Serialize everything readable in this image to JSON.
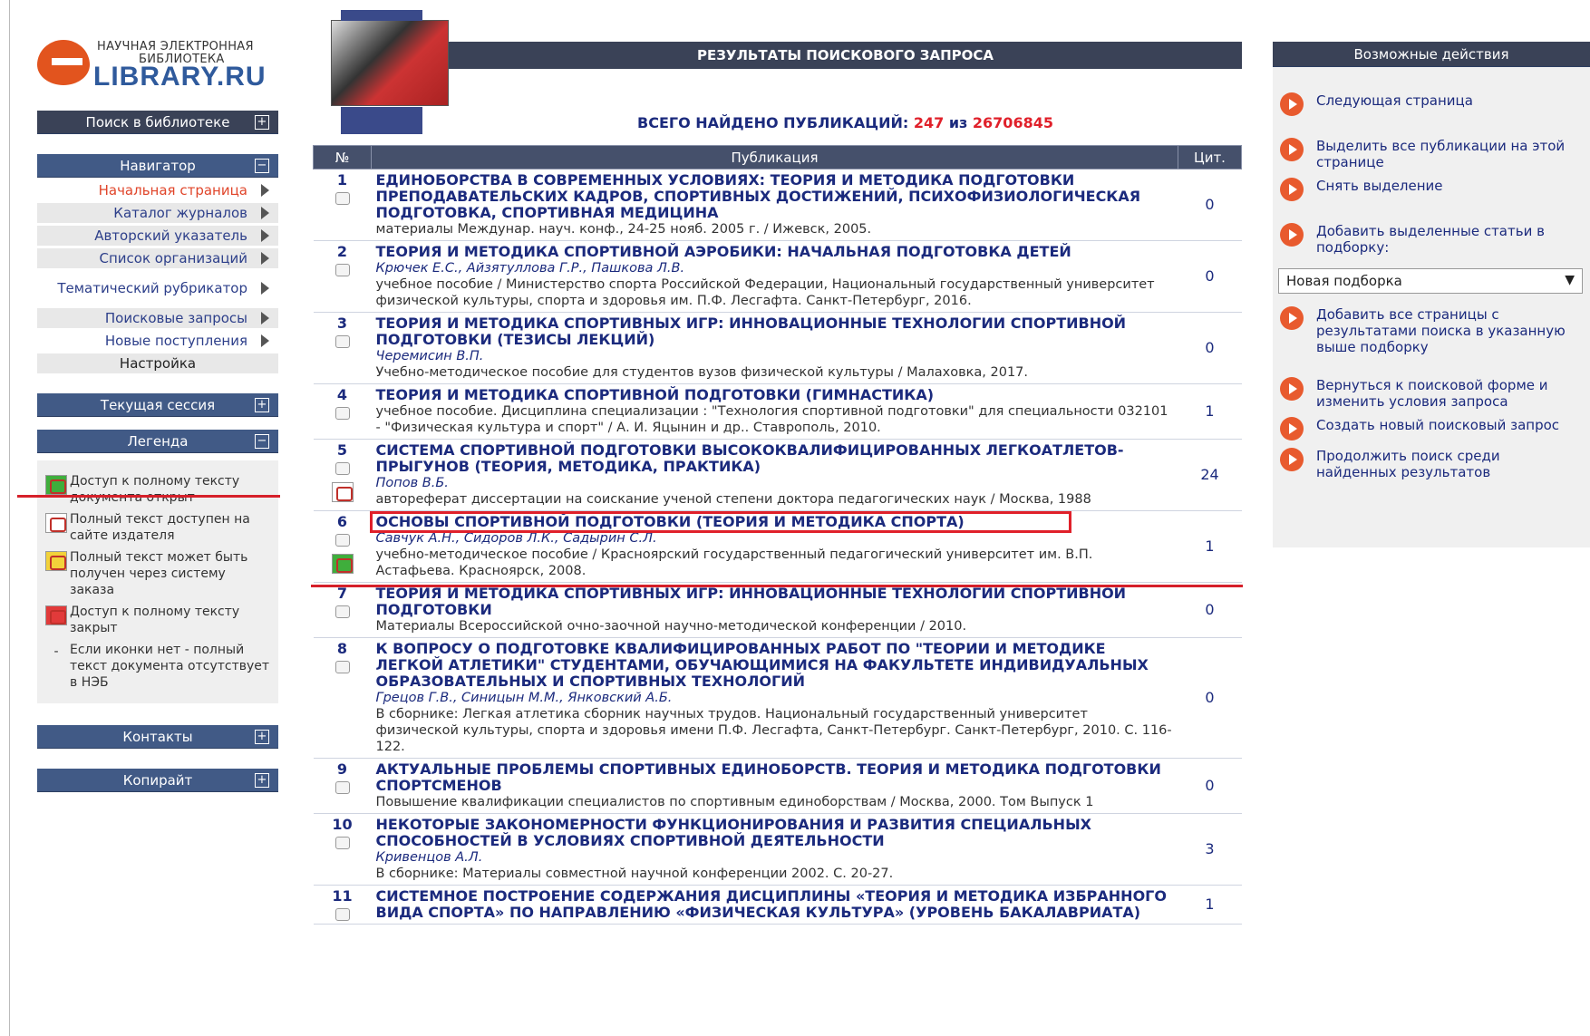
{
  "logo": {
    "line1": "НАУЧНАЯ ЭЛЕКТРОННАЯ",
    "line2": "БИБЛИОТЕКА",
    "line3": "LIBRARY.RU"
  },
  "left": {
    "search_bar": "Поиск в библиотеке",
    "nav_bar": "Навигатор",
    "nav_items": [
      {
        "label": "Начальная страница"
      },
      {
        "label": "Каталог журналов"
      },
      {
        "label": "Авторский указатель"
      },
      {
        "label": "Список организаций"
      },
      {
        "label": "Тематический рубрикатор"
      },
      {
        "label": "Поисковые запросы"
      },
      {
        "label": "Новые поступления"
      },
      {
        "label": "Настройка"
      }
    ],
    "session_bar": "Текущая сессия",
    "legend_bar": "Легенда",
    "legend": [
      {
        "icon": "pdf-open-icon",
        "text": "Доступ к полному тексту документа открыт"
      },
      {
        "icon": "pdf-publisher-icon",
        "text": "Полный текст доступен на сайте издателя"
      },
      {
        "icon": "pdf-order-icon",
        "text": "Полный текст может быть получен через систему заказа"
      },
      {
        "icon": "pdf-closed-icon",
        "text": "Доступ к полному тексту закрыт"
      },
      {
        "icon": "dash",
        "text": "Если иконки нет - полный текст документа отсутствует в НЭБ"
      }
    ],
    "contacts_bar": "Контакты",
    "copyright_bar": "Копирайт"
  },
  "center": {
    "title": "РЕЗУЛЬТАТЫ ПОИСКОВОГО ЗАПРОСА",
    "found_label": "ВСЕГО НАЙДЕНО ПУБЛИКАЦИЙ:",
    "found_count": "247",
    "found_of": "из",
    "found_total": "26706845",
    "col_no": "№",
    "col_pub": "Публикация",
    "col_cit": "Цит.",
    "rows": [
      {
        "n": "1",
        "title": "ЕДИНОБОРСТВА В СОВРЕМЕННЫХ УСЛОВИЯХ: ТЕОРИЯ И МЕТОДИКА ПОДГОТОВКИ ПРЕПОДАВАТЕЛЬСКИХ КАДРОВ, СПОРТИВНЫХ ДОСТИЖЕНИЙ, ПСИХОФИЗИОЛОГИЧЕСКАЯ ПОДГОТОВКА, СПОРТИВНАЯ МЕДИЦИНА",
        "authors": "",
        "meta": "материалы Междунар. науч. конф., 24-25 нояб. 2005 г. / Ижевск, 2005.",
        "cit": "0"
      },
      {
        "n": "2",
        "title": "ТЕОРИЯ И МЕТОДИКА СПОРТИВНОЙ АЭРОБИКИ: НАЧАЛЬНАЯ ПОДГОТОВКА ДЕТЕЙ",
        "authors": "Крючек Е.С., Айзятуллова Г.Р., Пашкова Л.В.",
        "meta": "учебное пособие / Министерство спорта Российской Федерации, Национальный государственный университет физической культуры, спорта и здоровья им. П.Ф. Лесгафта. Санкт-Петербург, 2016.",
        "cit": "0"
      },
      {
        "n": "3",
        "title": "ТЕОРИЯ И МЕТОДИКА СПОРТИВНЫХ ИГР: ИННОВАЦИОННЫЕ ТЕХНОЛОГИИ СПОРТИВНОЙ ПОДГОТОВКИ (ТЕЗИСЫ ЛЕКЦИЙ)",
        "authors": "Черемисин В.П.",
        "meta": "Учебно-методическое пособие для студентов вузов физической культуры / Малаховка, 2017.",
        "cit": "0"
      },
      {
        "n": "4",
        "title": "ТЕОРИЯ И МЕТОДИКА СПОРТИВНОЙ ПОДГОТОВКИ (ГИМНАСТИКА)",
        "authors": "",
        "meta": "учебное пособие. Дисциплина специализации : \"Технология спортивной подготовки\" для специальности 032101 - \"Физическая культура и спорт\" / А. И. Яцынин и др.. Ставрополь, 2010.",
        "cit": "1"
      },
      {
        "n": "5",
        "title": "СИСТЕМА СПОРТИВНОЙ ПОДГОТОВКИ ВЫСОКОКВАЛИФИЦИРОВАННЫХ ЛЕГКОАТЛЕТОВ-ПРЫГУНОВ (ТЕОРИЯ, МЕТОДИКА, ПРАКТИКА)",
        "authors": "Попов В.Б.",
        "meta": "автореферат диссертации на соискание ученой степени доктора педагогических наук / Москва, 1988",
        "cit": "24",
        "icon": "r"
      },
      {
        "n": "6",
        "title": "ОСНОВЫ СПОРТИВНОЙ ПОДГОТОВКИ (ТЕОРИЯ И МЕТОДИКА СПОРТА)",
        "authors": "Савчук А.Н., Сидоров Л.К., Садырин С.Л.",
        "meta": "учебно-методическое пособие / Красноярский государственный педагогический университет им. В.П. Астафьева. Красноярск, 2008.",
        "cit": "1",
        "icon": "g"
      },
      {
        "n": "7",
        "title": "ТЕОРИЯ И МЕТОДИКА СПОРТИВНЫХ ИГР: ИННОВАЦИОННЫЕ ТЕХНОЛОГИИ СПОРТИВНОЙ ПОДГОТОВКИ",
        "authors": "",
        "meta": "Материалы Всероссийской очно-заочной научно-методической конференции / 2010.",
        "cit": "0"
      },
      {
        "n": "8",
        "title": "К ВОПРОСУ О ПОДГОТОВКЕ КВАЛИФИЦИРОВАННЫХ РАБОТ ПО \"ТЕОРИИ И МЕТОДИКЕ ЛЕГКОЙ АТЛЕТИКИ\" СТУДЕНТАМИ, ОБУЧАЮЩИМИСЯ НА ФАКУЛЬТЕТЕ ИНДИВИДУАЛЬНЫХ ОБРАЗОВАТЕЛЬНЫХ И СПОРТИВНЫХ ТЕХНОЛОГИЙ",
        "authors": "Грецов Г.В., Синицын М.М., Янковский А.Б.",
        "meta": "В сборнике: Легкая атлетика сборник научных трудов. Национальный государственный университет физической культуры, спорта и здоровья имени П.Ф. Лесгафта, Санкт-Петербург. Санкт-Петербург, 2010. С. 116-122.",
        "cit": "0"
      },
      {
        "n": "9",
        "title": "АКТУАЛЬНЫЕ ПРОБЛЕМЫ СПОРТИВНЫХ ЕДИНОБОРСТВ. ТЕОРИЯ И МЕТОДИКА ПОДГОТОВКИ СПОРТСМЕНОВ",
        "authors": "",
        "meta": "Повышение квалификации специалистов по спортивным единоборствам / Москва, 2000. Том Выпуск 1",
        "cit": "0"
      },
      {
        "n": "10",
        "title": "НЕКОТОРЫЕ ЗАКОНОМЕРНОСТИ ФУНКЦИОНИРОВАНИЯ И РАЗВИТИЯ СПЕЦИАЛЬНЫХ СПОСОБНОСТЕЙ В УСЛОВИЯХ СПОРТИВНОЙ ДЕЯТЕЛЬНОСТИ",
        "authors": "Кривенцов А.Л.",
        "meta": "В сборнике: Материалы совместной научной конференции 2002. С. 20-27.",
        "cit": "3"
      },
      {
        "n": "11",
        "title": "СИСТЕМНОЕ ПОСТРОЕНИЕ СОДЕРЖАНИЯ ДИСЦИПЛИНЫ «ТЕОРИЯ И МЕТОДИКА ИЗБРАННОГО ВИДА СПОРТА» ПО НАПРАВЛЕНИЮ «ФИЗИЧЕСКАЯ КУЛЬТУРА» (УРОВЕНЬ БАКАЛАВРИАТА)",
        "authors": "",
        "meta": "",
        "cit": "1"
      }
    ]
  },
  "right": {
    "title": "Возможные действия",
    "actions": [
      "Следующая страница",
      "Выделить все публикации на этой странице",
      "Снять выделение",
      "Добавить выделенные статьи в подборку:"
    ],
    "select_value": "Новая подборка",
    "actions2": [
      "Добавить все страницы с результатами поиска в указанную выше подборку",
      "Вернуться к поисковой форме и изменить условия запроса",
      "Создать новый поисковый запрос",
      "Продолжить поиск среди найденных результатов"
    ]
  },
  "colors": {
    "accent": "#e0202a",
    "nav_bar": "#415a86",
    "dark_bar": "#3a4257",
    "link": "#1b2a7d"
  }
}
